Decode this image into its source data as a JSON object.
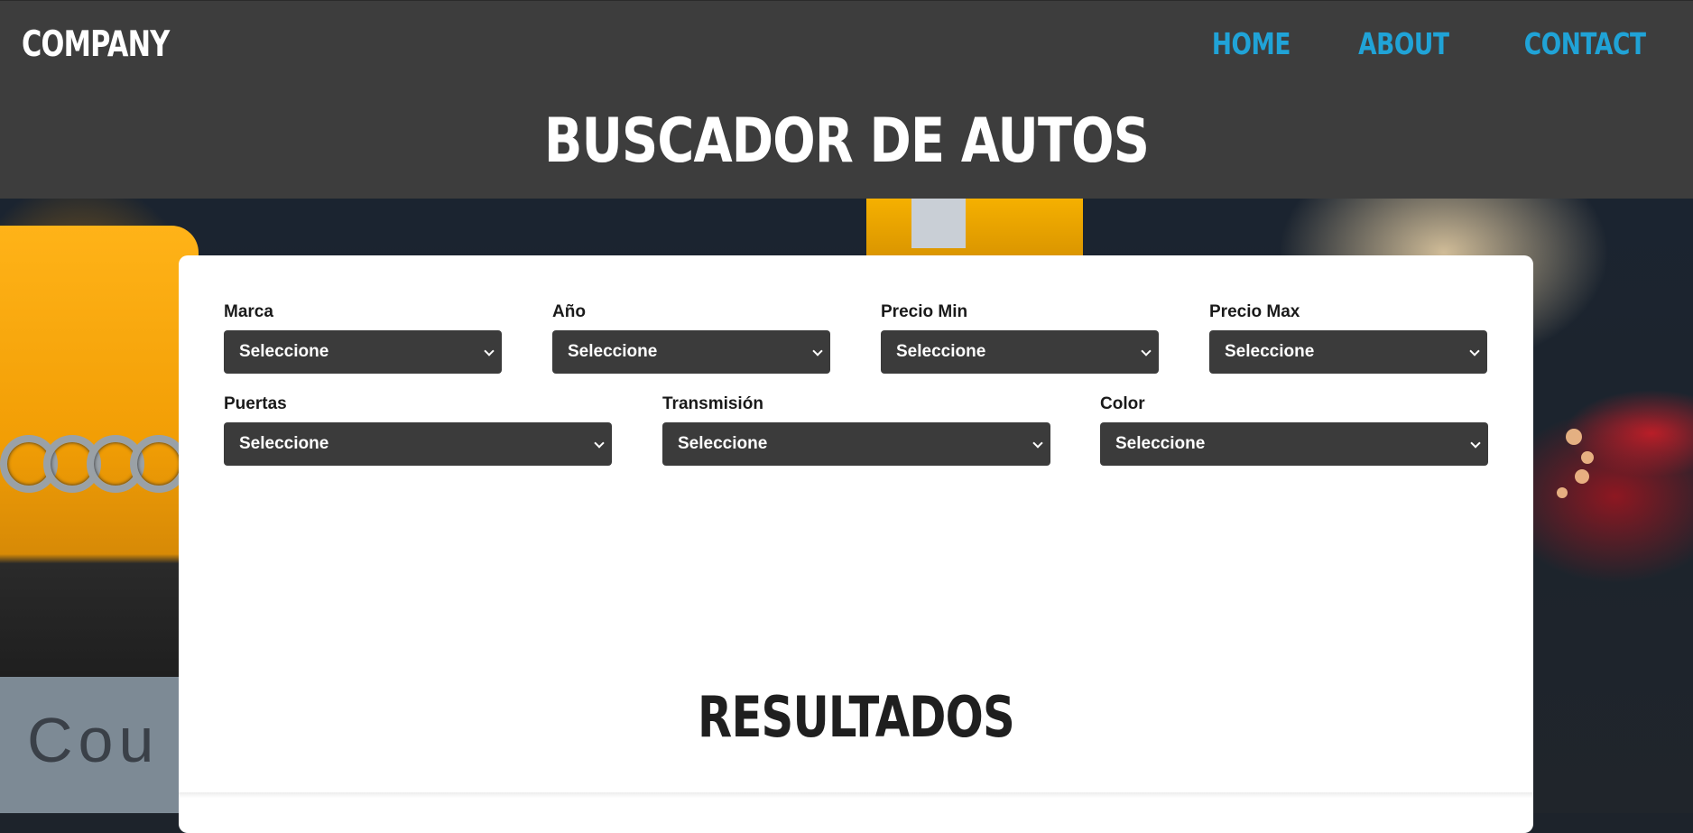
{
  "header": {
    "logo": "COMPANY",
    "nav": [
      "HOME",
      "ABOUT",
      "CONTACT"
    ],
    "title": "BUSCADOR DE AUTOS"
  },
  "hero": {
    "background_text": "Cou"
  },
  "form": {
    "row1": [
      {
        "label": "Marca",
        "value": "Seleccione"
      },
      {
        "label": "Año",
        "value": "Seleccione"
      },
      {
        "label": "Precio Min",
        "value": "Seleccione"
      },
      {
        "label": "Precio Max",
        "value": "Seleccione"
      }
    ],
    "row2": [
      {
        "label": "Puertas",
        "value": "Seleccione"
      },
      {
        "label": "Transmisión",
        "value": "Seleccione"
      },
      {
        "label": "Color",
        "value": "Seleccione"
      }
    ]
  },
  "results": {
    "title": "RESULTADOS"
  },
  "colors": {
    "header_bg": "#3d3d3d",
    "nav_link": "#20a3d7",
    "select_bg": "#3b3b3b",
    "card_bg": "#ffffff"
  },
  "icons": {
    "select_arrow": "chevron-down-icon"
  }
}
